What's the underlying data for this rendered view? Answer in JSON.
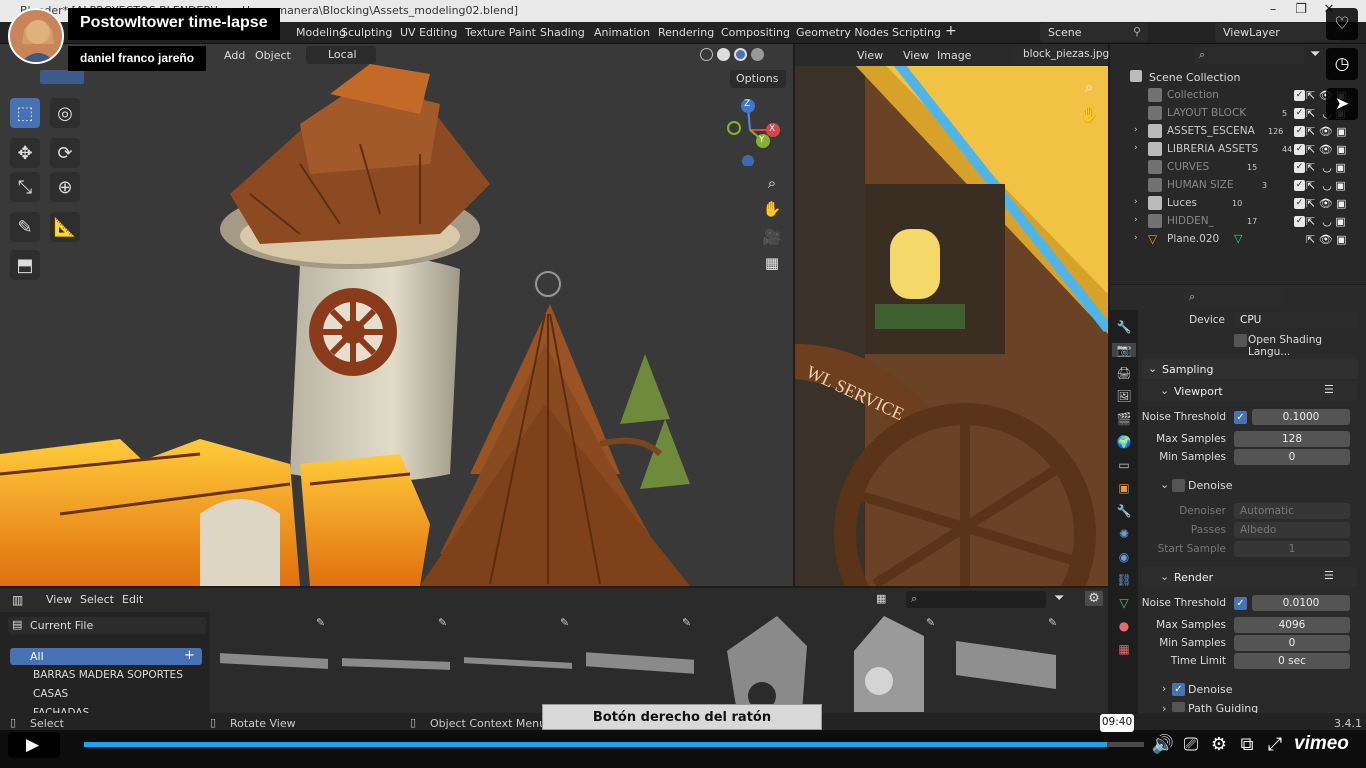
{
  "window": {
    "title": "Blender* [ALPROYECTOS BLENDER\\Low_Housemanera\\Blocking\\Assets_modeling02.blend]"
  },
  "workspaces": [
    "Modeling",
    "Sculpting",
    "UV Editing",
    "Texture Paint",
    "Shading",
    "Animation",
    "Rendering",
    "Compositing",
    "Geometry Nodes",
    "Scripting"
  ],
  "topbar": {
    "scene": "Scene",
    "view_layer": "ViewLayer",
    "add_tab": "+"
  },
  "viewport": {
    "menus": [
      "Add",
      "Object"
    ],
    "orientation": "Local",
    "options": "Options",
    "axes": {
      "z": "Z",
      "x": "X",
      "y": "Y"
    }
  },
  "image_editor": {
    "menus": [
      "View",
      "View",
      "Image"
    ],
    "image_name": "block_piezas.jpg"
  },
  "outliner": {
    "root": "Scene Collection",
    "items": [
      {
        "name": "Collection",
        "badge": ""
      },
      {
        "name": "LAYOUT BLOCK",
        "badge": "5"
      },
      {
        "name": "ASSETS_ESCENA",
        "badge": "126"
      },
      {
        "name": "LIBRERIA ASSETS",
        "badge": "44"
      },
      {
        "name": "CURVES",
        "badge": "15"
      },
      {
        "name": "HUMAN SIZE",
        "badge": "3"
      },
      {
        "name": "Luces",
        "badge": "10"
      },
      {
        "name": "HIDDEN_",
        "badge": "17"
      },
      {
        "name": "Plane.020",
        "badge": ""
      }
    ]
  },
  "properties": {
    "device_label": "Device",
    "device_value": "CPU",
    "osl_label": "Open Shading Langu...",
    "sampling": "Sampling",
    "viewport": "Viewport",
    "viewport_noise_label": "Noise Threshold",
    "viewport_noise_value": "0.1000",
    "viewport_max_label": "Max Samples",
    "viewport_max_value": "128",
    "viewport_min_label": "Min Samples",
    "viewport_min_value": "0",
    "denoise": "Denoise",
    "denoiser_label": "Denoiser",
    "denoiser_value": "Automatic",
    "passes_label": "Passes",
    "passes_value": "Albedo",
    "start_label": "Start Sample",
    "start_value": "1",
    "render": "Render",
    "render_noise_label": "Noise Threshold",
    "render_noise_value": "0.0100",
    "render_max_label": "Max Samples",
    "render_max_value": "4096",
    "render_min_label": "Min Samples",
    "render_min_value": "0",
    "time_label": "Time Limit",
    "time_value": "0 sec",
    "denoise2": "Denoise",
    "path_guiding": "Path Guiding"
  },
  "asset_browser": {
    "menus": [
      "View",
      "Select",
      "Edit"
    ],
    "library": "Current File",
    "categories": [
      "All",
      "BARRAS MADERA SOPORTES",
      "CASAS",
      "FACHADAS"
    ]
  },
  "status_bar": {
    "select": "Select",
    "rotate": "Rotate View",
    "context": "Object Context Menu",
    "version": "3.4.1"
  },
  "video": {
    "title": "PostowItower time-lapse",
    "author": "daniel franco jareño",
    "caption": "Botón derecho del ratón",
    "time": "09:40",
    "progress": 0.965,
    "brand": "vimeo"
  }
}
